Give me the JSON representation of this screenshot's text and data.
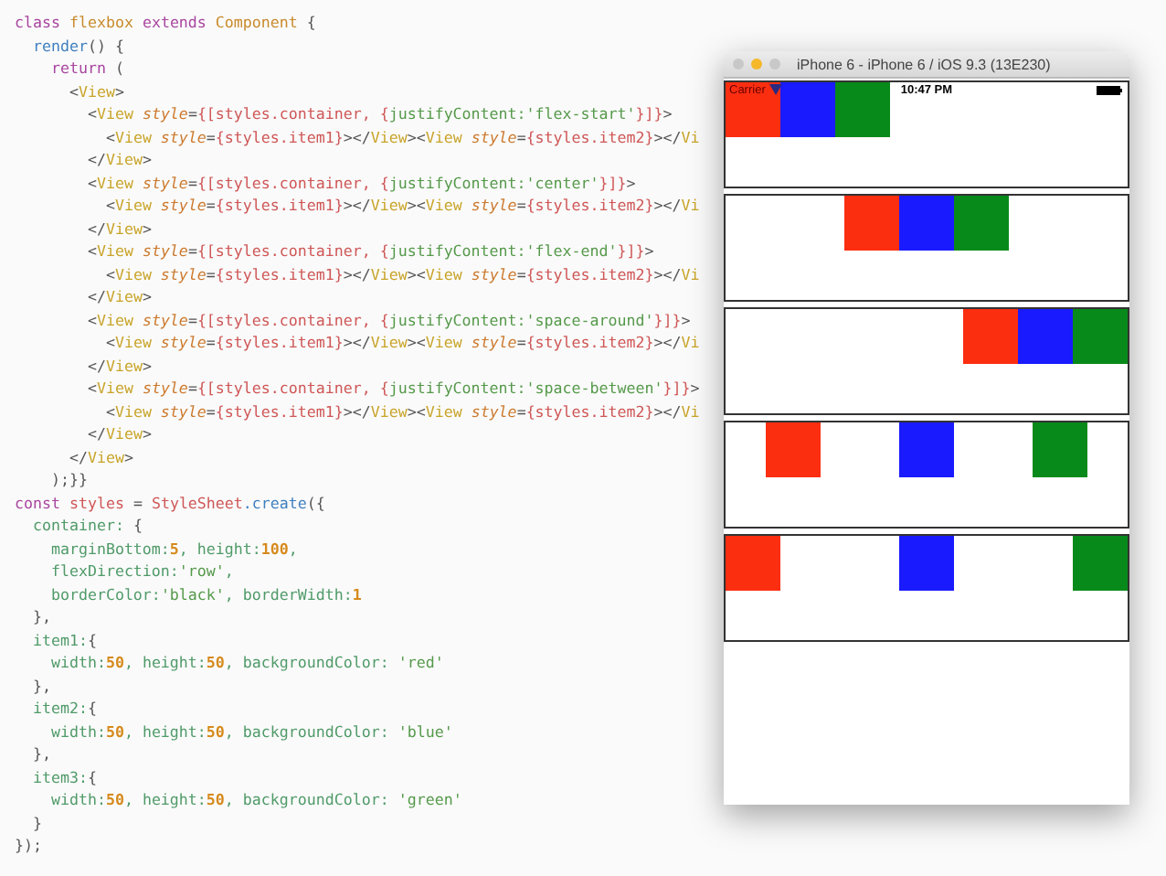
{
  "editor": {
    "lines": [
      [
        {
          "kind": "keyword",
          "text": "class "
        },
        {
          "kind": "type",
          "text": "flexbox "
        },
        {
          "kind": "keyword",
          "text": "extends "
        },
        {
          "kind": "type",
          "text": "Component "
        },
        {
          "kind": "plain",
          "text": "{"
        }
      ],
      [
        {
          "kind": "function",
          "text": "  render"
        },
        {
          "kind": "plain",
          "text": "() {"
        }
      ],
      [
        {
          "kind": "keyword",
          "text": "    return "
        },
        {
          "kind": "plain",
          "text": "("
        }
      ],
      [
        {
          "kind": "plain",
          "text": "      <"
        },
        {
          "kind": "tag",
          "text": "View"
        },
        {
          "kind": "plain",
          "text": ">"
        }
      ],
      [
        {
          "kind": "plain",
          "text": "        <"
        },
        {
          "kind": "tag",
          "text": "View"
        },
        {
          "kind": "attribute",
          "text": " style"
        },
        {
          "kind": "plain",
          "text": "="
        },
        {
          "kind": "variable",
          "text": "{[styles.container, {"
        },
        {
          "kind": "string",
          "text": "justifyContent:'flex-start'"
        },
        {
          "kind": "variable",
          "text": "}]}"
        },
        {
          "kind": "plain",
          "text": ">"
        }
      ],
      [
        {
          "kind": "plain",
          "text": "          <"
        },
        {
          "kind": "tag",
          "text": "View"
        },
        {
          "kind": "attribute",
          "text": " style"
        },
        {
          "kind": "plain",
          "text": "="
        },
        {
          "kind": "variable",
          "text": "{styles.item1}"
        },
        {
          "kind": "plain",
          "text": "></"
        },
        {
          "kind": "tag",
          "text": "View"
        },
        {
          "kind": "plain",
          "text": "><"
        },
        {
          "kind": "tag",
          "text": "View"
        },
        {
          "kind": "attribute",
          "text": " style"
        },
        {
          "kind": "plain",
          "text": "="
        },
        {
          "kind": "variable",
          "text": "{styles.item2}"
        },
        {
          "kind": "plain",
          "text": "></"
        },
        {
          "kind": "tag",
          "text": "Vi"
        }
      ],
      [
        {
          "kind": "plain",
          "text": "        </"
        },
        {
          "kind": "tag",
          "text": "View"
        },
        {
          "kind": "plain",
          "text": ">"
        }
      ],
      [
        {
          "kind": "plain",
          "text": "        <"
        },
        {
          "kind": "tag",
          "text": "View"
        },
        {
          "kind": "attribute",
          "text": " style"
        },
        {
          "kind": "plain",
          "text": "="
        },
        {
          "kind": "variable",
          "text": "{[styles.container, {"
        },
        {
          "kind": "string",
          "text": "justifyContent:'center'"
        },
        {
          "kind": "variable",
          "text": "}]}"
        },
        {
          "kind": "plain",
          "text": ">"
        }
      ],
      [
        {
          "kind": "plain",
          "text": "          <"
        },
        {
          "kind": "tag",
          "text": "View"
        },
        {
          "kind": "attribute",
          "text": " style"
        },
        {
          "kind": "plain",
          "text": "="
        },
        {
          "kind": "variable",
          "text": "{styles.item1}"
        },
        {
          "kind": "plain",
          "text": "></"
        },
        {
          "kind": "tag",
          "text": "View"
        },
        {
          "kind": "plain",
          "text": "><"
        },
        {
          "kind": "tag",
          "text": "View"
        },
        {
          "kind": "attribute",
          "text": " style"
        },
        {
          "kind": "plain",
          "text": "="
        },
        {
          "kind": "variable",
          "text": "{styles.item2}"
        },
        {
          "kind": "plain",
          "text": "></"
        },
        {
          "kind": "tag",
          "text": "Vi"
        }
      ],
      [
        {
          "kind": "plain",
          "text": "        </"
        },
        {
          "kind": "tag",
          "text": "View"
        },
        {
          "kind": "plain",
          "text": ">"
        }
      ],
      [
        {
          "kind": "plain",
          "text": "        <"
        },
        {
          "kind": "tag",
          "text": "View"
        },
        {
          "kind": "attribute",
          "text": " style"
        },
        {
          "kind": "plain",
          "text": "="
        },
        {
          "kind": "variable",
          "text": "{[styles.container, {"
        },
        {
          "kind": "string",
          "text": "justifyContent:'flex-end'"
        },
        {
          "kind": "variable",
          "text": "}]}"
        },
        {
          "kind": "plain",
          "text": ">"
        }
      ],
      [
        {
          "kind": "plain",
          "text": "          <"
        },
        {
          "kind": "tag",
          "text": "View"
        },
        {
          "kind": "attribute",
          "text": " style"
        },
        {
          "kind": "plain",
          "text": "="
        },
        {
          "kind": "variable",
          "text": "{styles.item1}"
        },
        {
          "kind": "plain",
          "text": "></"
        },
        {
          "kind": "tag",
          "text": "View"
        },
        {
          "kind": "plain",
          "text": "><"
        },
        {
          "kind": "tag",
          "text": "View"
        },
        {
          "kind": "attribute",
          "text": " style"
        },
        {
          "kind": "plain",
          "text": "="
        },
        {
          "kind": "variable",
          "text": "{styles.item2}"
        },
        {
          "kind": "plain",
          "text": "></"
        },
        {
          "kind": "tag",
          "text": "Vi"
        }
      ],
      [
        {
          "kind": "plain",
          "text": "        </"
        },
        {
          "kind": "tag",
          "text": "View"
        },
        {
          "kind": "plain",
          "text": ">"
        }
      ],
      [
        {
          "kind": "plain",
          "text": "        <"
        },
        {
          "kind": "tag",
          "text": "View"
        },
        {
          "kind": "attribute",
          "text": " style"
        },
        {
          "kind": "plain",
          "text": "="
        },
        {
          "kind": "variable",
          "text": "{[styles.container, {"
        },
        {
          "kind": "string",
          "text": "justifyContent:'space-around'"
        },
        {
          "kind": "variable",
          "text": "}]}"
        },
        {
          "kind": "plain",
          "text": ">"
        }
      ],
      [
        {
          "kind": "plain",
          "text": "          <"
        },
        {
          "kind": "tag",
          "text": "View"
        },
        {
          "kind": "attribute",
          "text": " style"
        },
        {
          "kind": "plain",
          "text": "="
        },
        {
          "kind": "variable",
          "text": "{styles.item1}"
        },
        {
          "kind": "plain",
          "text": "></"
        },
        {
          "kind": "tag",
          "text": "View"
        },
        {
          "kind": "plain",
          "text": "><"
        },
        {
          "kind": "tag",
          "text": "View"
        },
        {
          "kind": "attribute",
          "text": " style"
        },
        {
          "kind": "plain",
          "text": "="
        },
        {
          "kind": "variable",
          "text": "{styles.item2}"
        },
        {
          "kind": "plain",
          "text": "></"
        },
        {
          "kind": "tag",
          "text": "Vi"
        }
      ],
      [
        {
          "kind": "plain",
          "text": "        </"
        },
        {
          "kind": "tag",
          "text": "View"
        },
        {
          "kind": "plain",
          "text": ">"
        }
      ],
      [
        {
          "kind": "plain",
          "text": "        <"
        },
        {
          "kind": "tag",
          "text": "View"
        },
        {
          "kind": "attribute",
          "text": " style"
        },
        {
          "kind": "plain",
          "text": "="
        },
        {
          "kind": "variable",
          "text": "{[styles.container, {"
        },
        {
          "kind": "string",
          "text": "justifyContent:'space-between'"
        },
        {
          "kind": "variable",
          "text": "}]}"
        },
        {
          "kind": "plain",
          "text": ">"
        }
      ],
      [
        {
          "kind": "plain",
          "text": "          <"
        },
        {
          "kind": "tag",
          "text": "View"
        },
        {
          "kind": "attribute",
          "text": " style"
        },
        {
          "kind": "plain",
          "text": "="
        },
        {
          "kind": "variable",
          "text": "{styles.item1}"
        },
        {
          "kind": "plain",
          "text": "></"
        },
        {
          "kind": "tag",
          "text": "View"
        },
        {
          "kind": "plain",
          "text": "><"
        },
        {
          "kind": "tag",
          "text": "View"
        },
        {
          "kind": "attribute",
          "text": " style"
        },
        {
          "kind": "plain",
          "text": "="
        },
        {
          "kind": "variable",
          "text": "{styles.item2}"
        },
        {
          "kind": "plain",
          "text": "></"
        },
        {
          "kind": "tag",
          "text": "Vi"
        }
      ],
      [
        {
          "kind": "plain",
          "text": "        </"
        },
        {
          "kind": "tag",
          "text": "View"
        },
        {
          "kind": "plain",
          "text": ">"
        }
      ],
      [
        {
          "kind": "plain",
          "text": "      </"
        },
        {
          "kind": "tag",
          "text": "View"
        },
        {
          "kind": "plain",
          "text": ">"
        }
      ],
      [
        {
          "kind": "plain",
          "text": "    );}}"
        }
      ],
      [
        {
          "kind": "keyword",
          "text": "const "
        },
        {
          "kind": "variable",
          "text": "styles "
        },
        {
          "kind": "plain",
          "text": "= "
        },
        {
          "kind": "variable",
          "text": "StyleSheet"
        },
        {
          "kind": "function",
          "text": ".create"
        },
        {
          "kind": "plain",
          "text": "({"
        }
      ],
      [
        {
          "kind": "key",
          "text": "  container: "
        },
        {
          "kind": "plain",
          "text": "{"
        }
      ],
      [
        {
          "kind": "key",
          "text": "    marginBottom:"
        },
        {
          "kind": "number",
          "text": "5"
        },
        {
          "kind": "key",
          "text": ", height:"
        },
        {
          "kind": "number",
          "text": "100"
        },
        {
          "kind": "key",
          "text": ","
        }
      ],
      [
        {
          "kind": "key",
          "text": "    flexDirection:"
        },
        {
          "kind": "string",
          "text": "'row'"
        },
        {
          "kind": "key",
          "text": ","
        }
      ],
      [
        {
          "kind": "key",
          "text": "    borderColor:"
        },
        {
          "kind": "string",
          "text": "'black'"
        },
        {
          "kind": "key",
          "text": ", borderWidth:"
        },
        {
          "kind": "number",
          "text": "1"
        }
      ],
      [
        {
          "kind": "plain",
          "text": "  },"
        }
      ],
      [
        {
          "kind": "key",
          "text": "  item1:"
        },
        {
          "kind": "plain",
          "text": "{"
        }
      ],
      [
        {
          "kind": "key",
          "text": "    width:"
        },
        {
          "kind": "number",
          "text": "50"
        },
        {
          "kind": "key",
          "text": ", height:"
        },
        {
          "kind": "number",
          "text": "50"
        },
        {
          "kind": "key",
          "text": ", backgroundColor: "
        },
        {
          "kind": "string",
          "text": "'red'"
        }
      ],
      [
        {
          "kind": "plain",
          "text": "  },"
        }
      ],
      [
        {
          "kind": "key",
          "text": "  item2:"
        },
        {
          "kind": "plain",
          "text": "{"
        }
      ],
      [
        {
          "kind": "key",
          "text": "    width:"
        },
        {
          "kind": "number",
          "text": "50"
        },
        {
          "kind": "key",
          "text": ", height:"
        },
        {
          "kind": "number",
          "text": "50"
        },
        {
          "kind": "key",
          "text": ", backgroundColor: "
        },
        {
          "kind": "string",
          "text": "'blue'"
        }
      ],
      [
        {
          "kind": "plain",
          "text": "  },"
        }
      ],
      [
        {
          "kind": "key",
          "text": "  item3:"
        },
        {
          "kind": "plain",
          "text": "{"
        }
      ],
      [
        {
          "kind": "key",
          "text": "    width:"
        },
        {
          "kind": "number",
          "text": "50"
        },
        {
          "kind": "key",
          "text": ", height:"
        },
        {
          "kind": "number",
          "text": "50"
        },
        {
          "kind": "key",
          "text": ", backgroundColor: "
        },
        {
          "kind": "string",
          "text": "'green'"
        }
      ],
      [
        {
          "kind": "plain",
          "text": "  }"
        }
      ],
      [
        {
          "kind": "plain",
          "text": "});"
        }
      ]
    ]
  },
  "simulator": {
    "title": "iPhone 6 - iPhone 6 / iOS 9.3 (13E230)",
    "status_bar": {
      "carrier": "Carrier",
      "time": "10:47 PM"
    },
    "containers": [
      {
        "kind": "start",
        "items": [
          {
            "color": "#fc2e10"
          },
          {
            "color": "#1a1aff"
          },
          {
            "color": "#078a1a"
          }
        ]
      },
      {
        "kind": "center",
        "items": [
          {
            "color": "#fc2e10"
          },
          {
            "color": "#1a1aff"
          },
          {
            "color": "#078a1a"
          }
        ]
      },
      {
        "kind": "end",
        "items": [
          {
            "color": "#fc2e10"
          },
          {
            "color": "#1a1aff"
          },
          {
            "color": "#078a1a"
          }
        ]
      },
      {
        "kind": "around",
        "items": [
          {
            "color": "#fc2e10"
          },
          {
            "color": "#1a1aff"
          },
          {
            "color": "#078a1a"
          }
        ]
      },
      {
        "kind": "between",
        "items": [
          {
            "color": "#fc2e10"
          },
          {
            "color": "#1a1aff"
          },
          {
            "color": "#078a1a"
          }
        ]
      }
    ]
  }
}
